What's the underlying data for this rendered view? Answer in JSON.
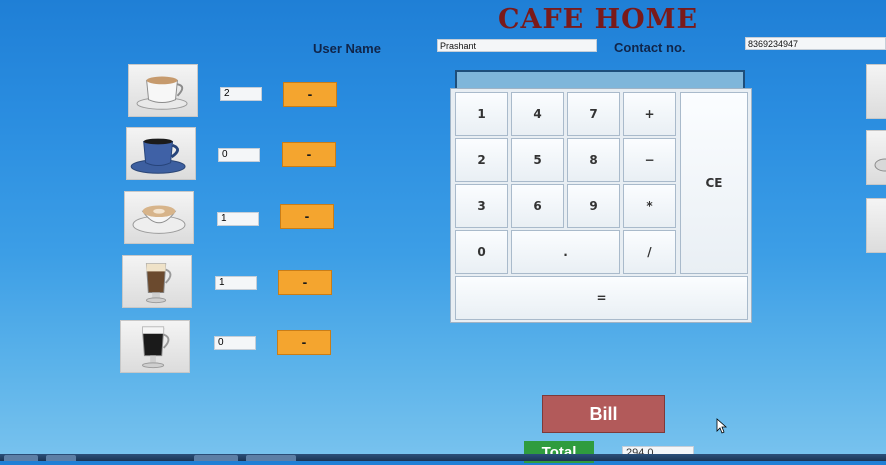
{
  "app": {
    "title": "CAFE HOME"
  },
  "header": {
    "user_label": "User Name",
    "user_value": "Prashant",
    "contact_label": "Contact no.",
    "contact_value": "8369234947"
  },
  "items": [
    {
      "icon": "cappuccino-cup-icon",
      "qty": "2",
      "minus_label": "-"
    },
    {
      "icon": "black-coffee-cup-icon",
      "qty": "0",
      "minus_label": "-"
    },
    {
      "icon": "latte-cup-icon",
      "qty": "1",
      "minus_label": "-"
    },
    {
      "icon": "mocha-glass-icon",
      "qty": "1",
      "minus_label": "-"
    },
    {
      "icon": "irish-coffee-glass-icon",
      "qty": "0",
      "minus_label": "-"
    }
  ],
  "calculator": {
    "display": "",
    "keys": {
      "k1": "1",
      "k4": "4",
      "k7": "7",
      "plus": "+",
      "k2": "2",
      "k5": "5",
      "k8": "8",
      "minus": "−",
      "k3": "3",
      "k6": "6",
      "k9": "9",
      "multiply": "*",
      "k0": "0",
      "dot": ".",
      "divide": "/",
      "ce": "CE",
      "equals": "="
    }
  },
  "footer": {
    "bill_label": "Bill",
    "total_label": "Total",
    "total_value": "294.0"
  },
  "colors": {
    "title": "#7a1a1a",
    "minus_button": "#f4a52f",
    "bill_button": "#b25a5a",
    "total_label": "#2f9c3e"
  }
}
